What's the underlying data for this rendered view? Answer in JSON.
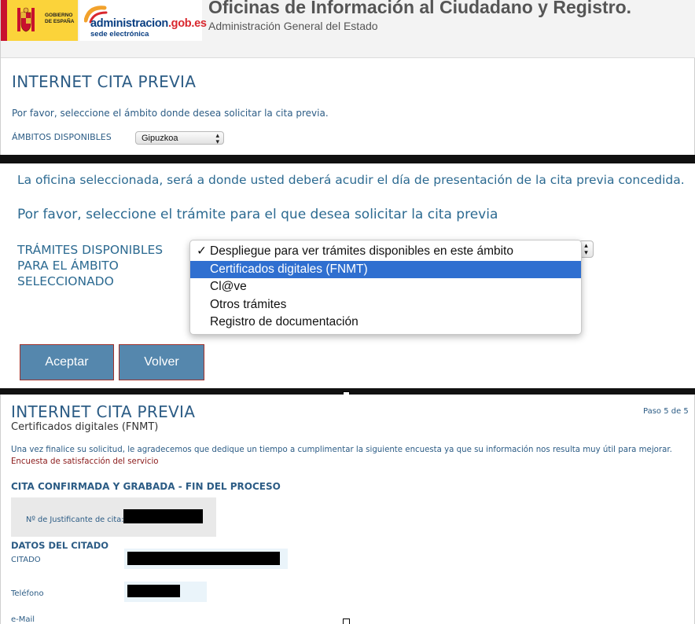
{
  "header": {
    "gov_logo_text": "GOBIERNO\nDE ESPAÑA",
    "admin_logo_main": "administracion",
    "admin_logo_domain": ".gob.es",
    "admin_logo_sub": "sede electrónica",
    "title": "Oficinas de Información al Ciudadano y Registro.",
    "subtitle": "Administración General del Estado"
  },
  "panel1": {
    "heading": "INTERNET CITA PREVIA",
    "instruction": "Por favor, seleccione el ámbito donde desea solicitar la cita previa.",
    "ambito_label": "ÁMBITOS DISPONIBLES",
    "ambito_selected": "Gipuzkoa"
  },
  "panel2": {
    "office_note": "La oficina seleccionada, será a donde usted deberá acudir el día de presentación de la cita previa concedida.",
    "instruction": "Por favor, seleccione el trámite para el que desea solicitar la cita previa",
    "tramites_label": "TRÁMITES DISPONIBLES PARA EL ÁMBITO SELECCIONADO",
    "dropdown_options": [
      {
        "label": "Despliegue para ver trámites disponibles en este ámbito",
        "checked": true
      },
      {
        "label": "Certificados digitales (FNMT)",
        "highlighted": true
      },
      {
        "label": "Cl@ve"
      },
      {
        "label": "Otros trámites"
      },
      {
        "label": "Registro de documentación"
      }
    ],
    "accept_label": "Aceptar",
    "back_label": "Volver"
  },
  "panel3": {
    "heading": "INTERNET CITA PREVIA",
    "subheading": "Certificados digitales (FNMT)",
    "step": "Paso 5 de 5",
    "survey_text": "Una vez finalice su solicitud, le agradecemos que dedique un tiempo a cumplimentar la siguiente encuesta ya que su información nos resulta muy útil para mejorar.",
    "survey_link": "Encuesta de satisfacción del servicio",
    "confirmed": "CITA CONFIRMADA Y GRABADA - FIN DEL PROCESO",
    "justificante_label": "Nº de Justificante de cita:",
    "datos_heading": "DATOS DEL CITADO",
    "citado_label": "CITADO",
    "telefono_label": "Teléfono",
    "email_label": "e-Mail"
  },
  "colors": {
    "heading_blue": "#2c5c85",
    "button_blue": "#5587ad",
    "button_border": "#a0322b",
    "highlight_blue": "#2f6fd0",
    "link_red": "#8b1a1a"
  }
}
